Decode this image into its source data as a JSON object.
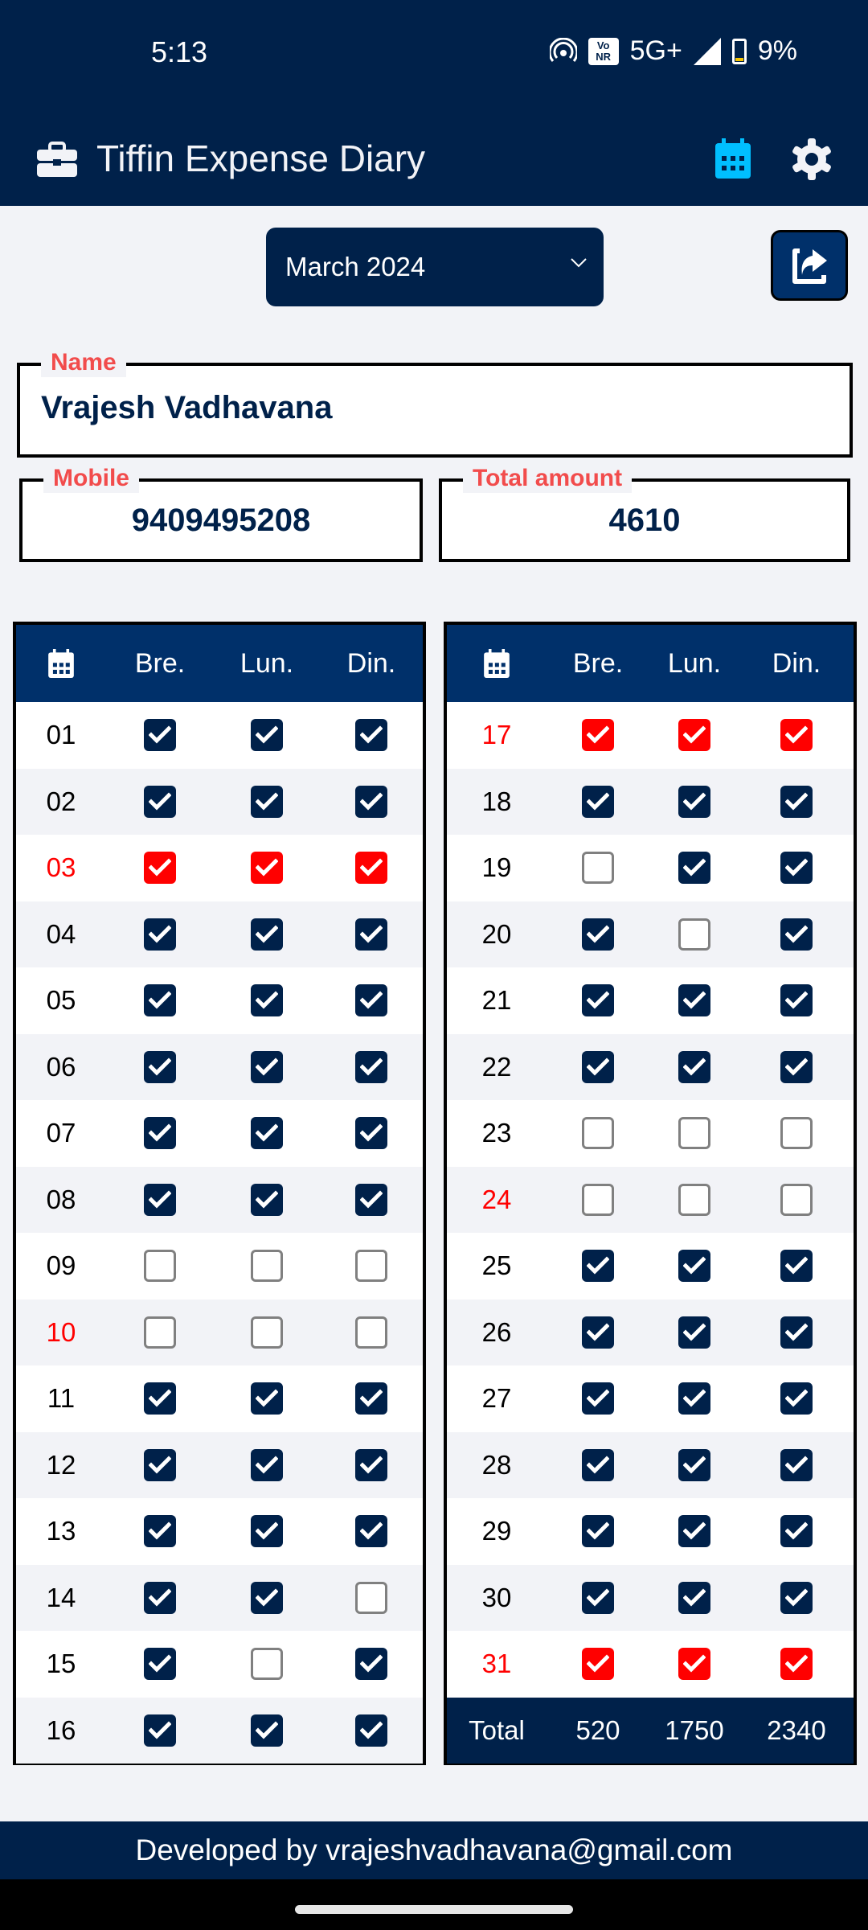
{
  "status_bar": {
    "time": "5:13",
    "network": "5G+",
    "vonr_badge": "Vo NR",
    "battery": "9%",
    "icons": [
      "hotspot-icon",
      "vonr-icon",
      "signal-icon",
      "battery-charging-icon"
    ]
  },
  "app_bar": {
    "title": "Tiffin Expense Diary",
    "icons": [
      "briefcase-icon",
      "calendar-icon",
      "gear-icon"
    ],
    "accent_color": "#00BFFF"
  },
  "month_selector": {
    "selected": "March 2024"
  },
  "share_button": {
    "icon": "share-icon"
  },
  "form": {
    "name_label": "Name",
    "name_value": "Vrajesh Vadhavana",
    "mobile_label": "Mobile",
    "mobile_value": "9409495208",
    "total_label": "Total amount",
    "total_value": "4610"
  },
  "grid": {
    "headers": [
      "calendar-icon",
      "Bre.",
      "Lun.",
      "Din."
    ],
    "left_days": [
      {
        "day": "01",
        "holiday": false,
        "b": true,
        "l": true,
        "d": true
      },
      {
        "day": "02",
        "holiday": false,
        "b": true,
        "l": true,
        "d": true
      },
      {
        "day": "03",
        "holiday": true,
        "b": true,
        "l": true,
        "d": true
      },
      {
        "day": "04",
        "holiday": false,
        "b": true,
        "l": true,
        "d": true
      },
      {
        "day": "05",
        "holiday": false,
        "b": true,
        "l": true,
        "d": true
      },
      {
        "day": "06",
        "holiday": false,
        "b": true,
        "l": true,
        "d": true
      },
      {
        "day": "07",
        "holiday": false,
        "b": true,
        "l": true,
        "d": true
      },
      {
        "day": "08",
        "holiday": false,
        "b": true,
        "l": true,
        "d": true
      },
      {
        "day": "09",
        "holiday": false,
        "b": false,
        "l": false,
        "d": false
      },
      {
        "day": "10",
        "holiday": true,
        "b": false,
        "l": false,
        "d": false
      },
      {
        "day": "11",
        "holiday": false,
        "b": true,
        "l": true,
        "d": true
      },
      {
        "day": "12",
        "holiday": false,
        "b": true,
        "l": true,
        "d": true
      },
      {
        "day": "13",
        "holiday": false,
        "b": true,
        "l": true,
        "d": true
      },
      {
        "day": "14",
        "holiday": false,
        "b": true,
        "l": true,
        "d": false
      },
      {
        "day": "15",
        "holiday": false,
        "b": true,
        "l": false,
        "d": true
      },
      {
        "day": "16",
        "holiday": false,
        "b": true,
        "l": true,
        "d": true
      }
    ],
    "right_days": [
      {
        "day": "17",
        "holiday": true,
        "b": true,
        "l": true,
        "d": true
      },
      {
        "day": "18",
        "holiday": false,
        "b": true,
        "l": true,
        "d": true
      },
      {
        "day": "19",
        "holiday": false,
        "b": false,
        "l": true,
        "d": true
      },
      {
        "day": "20",
        "holiday": false,
        "b": true,
        "l": false,
        "d": true
      },
      {
        "day": "21",
        "holiday": false,
        "b": true,
        "l": true,
        "d": true
      },
      {
        "day": "22",
        "holiday": false,
        "b": true,
        "l": true,
        "d": true
      },
      {
        "day": "23",
        "holiday": false,
        "b": false,
        "l": false,
        "d": false
      },
      {
        "day": "24",
        "holiday": true,
        "b": false,
        "l": false,
        "d": false
      },
      {
        "day": "25",
        "holiday": false,
        "b": true,
        "l": true,
        "d": true
      },
      {
        "day": "26",
        "holiday": false,
        "b": true,
        "l": true,
        "d": true
      },
      {
        "day": "27",
        "holiday": false,
        "b": true,
        "l": true,
        "d": true
      },
      {
        "day": "28",
        "holiday": false,
        "b": true,
        "l": true,
        "d": true
      },
      {
        "day": "29",
        "holiday": false,
        "b": true,
        "l": true,
        "d": true
      },
      {
        "day": "30",
        "holiday": false,
        "b": true,
        "l": true,
        "d": true
      },
      {
        "day": "31",
        "holiday": true,
        "b": true,
        "l": true,
        "d": true
      }
    ],
    "totals": {
      "label": "Total",
      "breakfast": "520",
      "lunch": "1750",
      "dinner": "2340"
    }
  },
  "footer": {
    "text": "Developed by vrajeshvadhavana@gmail.com"
  },
  "colors": {
    "primary": "#00214A",
    "header": "#00306A",
    "holiday": "#FF0000",
    "label": "#F24C4C"
  }
}
